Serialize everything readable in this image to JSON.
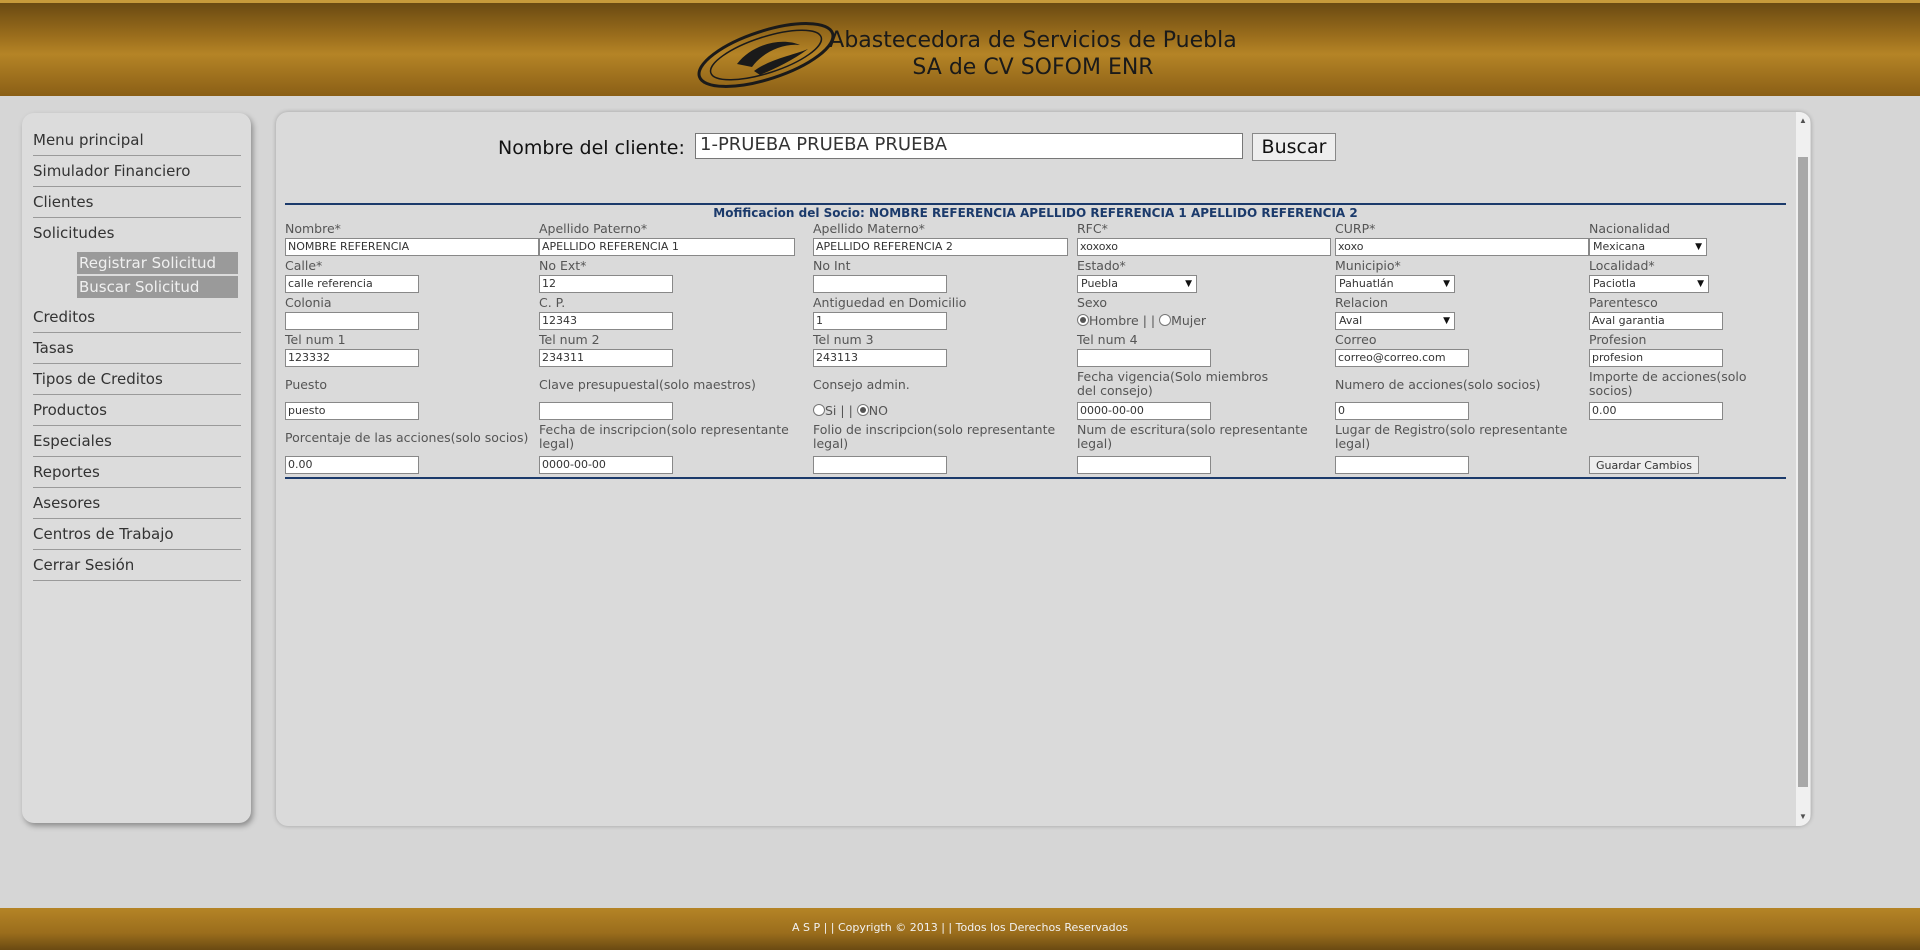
{
  "header": {
    "company_line1": "Abastecedora de Servicios de Puebla",
    "company_line2": "SA de CV SOFOM ENR"
  },
  "sidebar": {
    "items": [
      {
        "label": "Menu principal"
      },
      {
        "label": "Simulador Financiero"
      },
      {
        "label": "Clientes"
      },
      {
        "label": "Solicitudes"
      },
      {
        "label": "Creditos"
      },
      {
        "label": "Tasas"
      },
      {
        "label": "Tipos de Creditos"
      },
      {
        "label": "Productos"
      },
      {
        "label": "Especiales"
      },
      {
        "label": "Reportes"
      },
      {
        "label": "Asesores"
      },
      {
        "label": "Centros de Trabajo"
      },
      {
        "label": "Cerrar Sesión"
      }
    ],
    "submenu": [
      {
        "label": "Registrar Solicitud"
      },
      {
        "label": "Buscar Solicitud"
      }
    ]
  },
  "search": {
    "label": "Nombre del cliente:",
    "value": "1-PRUEBA PRUEBA PRUEBA",
    "button": "Buscar"
  },
  "form": {
    "title": "Mofificacion del Socio: NOMBRE REFERENCIA APELLIDO REFERENCIA 1 APELLIDO REFERENCIA 2",
    "nombre": {
      "label": "Nombre*",
      "value": "NOMBRE REFERENCIA"
    },
    "apellido_paterno": {
      "label": "Apellido Paterno*",
      "value": "APELLIDO REFERENCIA 1"
    },
    "apellido_materno": {
      "label": "Apellido Materno*",
      "value": "APELLIDO REFERENCIA 2"
    },
    "rfc": {
      "label": "RFC*",
      "value": "xoxoxo"
    },
    "curp": {
      "label": "CURP*",
      "value": "xoxo"
    },
    "nacionalidad": {
      "label": "Nacionalidad",
      "value": "Mexicana"
    },
    "calle": {
      "label": "Calle*",
      "value": "calle referencia"
    },
    "no_ext": {
      "label": "No Ext*",
      "value": "12"
    },
    "no_int": {
      "label": "No Int",
      "value": ""
    },
    "estado": {
      "label": "Estado*",
      "value": "Puebla"
    },
    "municipio": {
      "label": "Municipio*",
      "value": "Pahuatlán"
    },
    "localidad": {
      "label": "Localidad*",
      "value": "Paciotla"
    },
    "colonia": {
      "label": "Colonia",
      "value": ""
    },
    "cp": {
      "label": "C. P.",
      "value": "12343"
    },
    "antiguedad": {
      "label": "Antiguedad en Domicilio",
      "value": "1"
    },
    "sexo": {
      "label": "Sexo",
      "opt1": "Hombre",
      "sep": " | | ",
      "opt2": "Mujer",
      "selected": "Hombre"
    },
    "relacion": {
      "label": "Relacion",
      "value": "Aval"
    },
    "parentesco": {
      "label": "Parentesco",
      "value": "Aval garantia"
    },
    "tel1": {
      "label": "Tel num 1",
      "value": "123332"
    },
    "tel2": {
      "label": "Tel num 2",
      "value": "234311"
    },
    "tel3": {
      "label": "Tel num 3",
      "value": "243113"
    },
    "tel4": {
      "label": "Tel num 4",
      "value": ""
    },
    "correo": {
      "label": "Correo",
      "value": "correo@correo.com"
    },
    "profesion": {
      "label": "Profesion",
      "value": "profesion"
    },
    "puesto": {
      "label": "Puesto",
      "value": "puesto"
    },
    "clave_presupuestal": {
      "label": "Clave presupuestal(solo maestros)",
      "value": ""
    },
    "consejo": {
      "label": "Consejo admin.",
      "opt1": "Si",
      "sep": " | | ",
      "opt2": "NO",
      "selected": "NO"
    },
    "fecha_vigencia": {
      "label": "Fecha vigencia(Solo miembros del consejo)",
      "value": "0000-00-00"
    },
    "num_acciones": {
      "label": "Numero de acciones(solo socios)",
      "value": "0"
    },
    "importe_acciones": {
      "label": "Importe de acciones(solo socios)",
      "value": "0.00"
    },
    "porcentaje_acciones": {
      "label": "Porcentaje de las acciones(solo socios)",
      "value": "0.00"
    },
    "fecha_inscripcion": {
      "label": "Fecha de inscripcion(solo representante legal)",
      "value": "0000-00-00"
    },
    "folio_inscripcion": {
      "label": "Folio de inscripcion(solo representante legal)",
      "value": ""
    },
    "num_escritura": {
      "label": "Num de escritura(solo representante legal)",
      "value": ""
    },
    "lugar_registro": {
      "label": "Lugar de Registro(solo representante legal)",
      "value": ""
    },
    "save_button": "Guardar Cambios"
  },
  "footer": {
    "text": "A S P  | |  Copyrigth © 2013  | |  Todos los Derechos Reservados"
  }
}
